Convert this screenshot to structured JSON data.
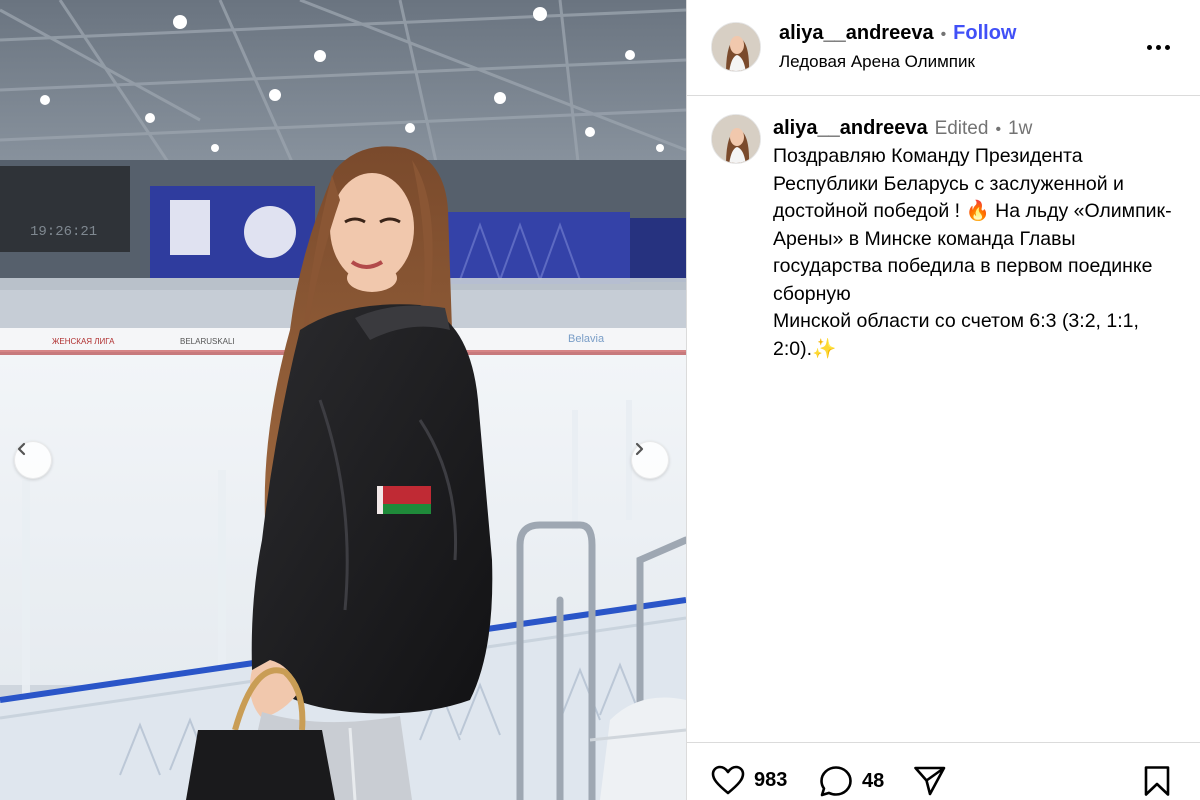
{
  "post": {
    "username": "aliya__andreeva",
    "follow_label": "Follow",
    "location": "Ледовая Арена Олимпик",
    "edited_label": "Edited",
    "time": "1w",
    "separator": "•",
    "caption": [
      "Поздравляю Команду Президента Республики Беларусь с заслуженной и достойной победой ! 🔥 На льду «Олимпик-Арены» в Минске команда Главы государства победила в первом поединке сборную",
      "Минской области со счетом 6:3 (3:2, 1:1, 2:0).✨"
    ]
  },
  "media": {
    "scoreboard_time": "19:26:21",
    "board_text_1": "ЖЕНСКАЯ ЛИГА",
    "board_text_2": "BELARUSKALI",
    "board_text_3": "Belavia",
    "prev_icon": "chevron-left-icon",
    "next_icon": "chevron-right-icon"
  },
  "actions": {
    "likes": "983",
    "comments": "48",
    "icons": [
      "heart-icon",
      "comment-icon",
      "share-icon",
      "bookmark-icon"
    ]
  },
  "colors": {
    "follow": "#4150f7",
    "muted": "#737373",
    "divider": "#dbdbdb"
  }
}
